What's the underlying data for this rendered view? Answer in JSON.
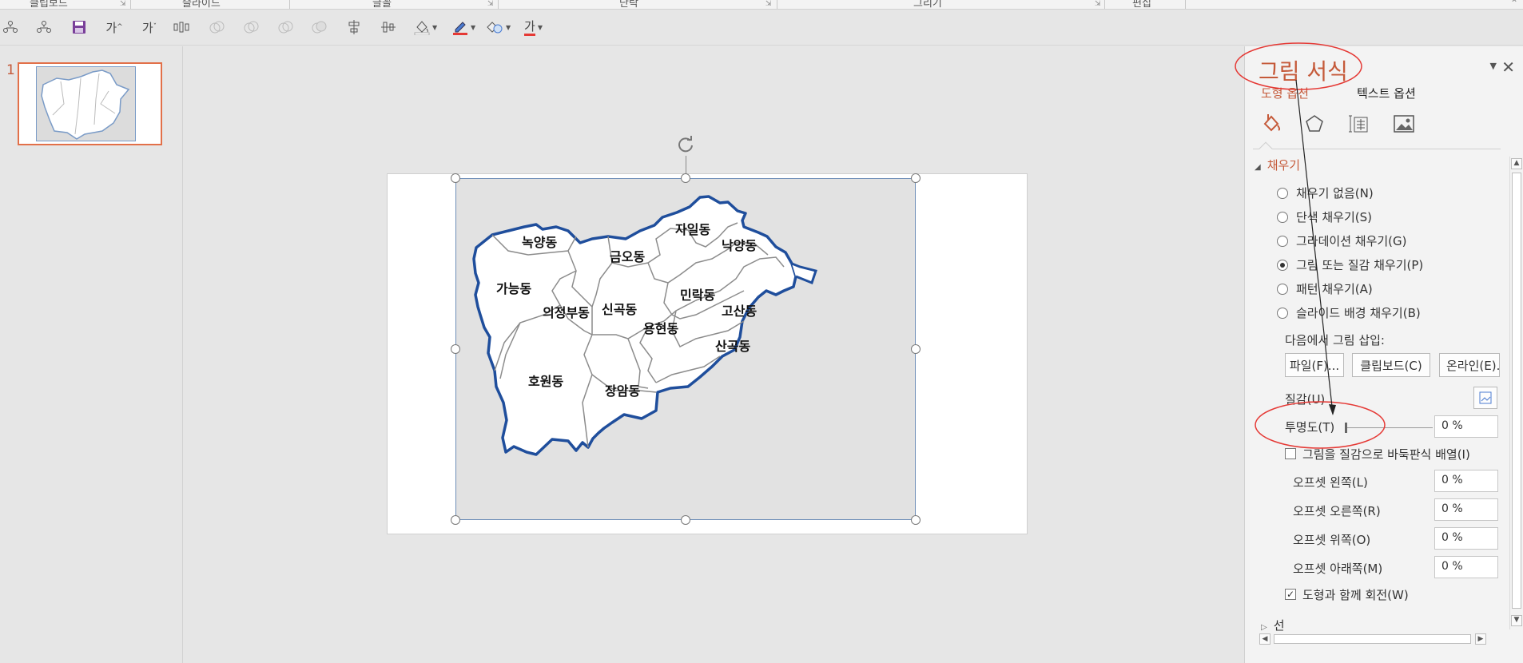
{
  "ribbon": {
    "groups": [
      "클립보드",
      "슬라이드",
      "글꼴",
      "단락",
      "그리기",
      "편집"
    ]
  },
  "toolbar": {
    "font_size_up": "가",
    "font_size_down": "가",
    "text_color_label": "가"
  },
  "slides_panel": {
    "slide_number": "1"
  },
  "map": {
    "districts": [
      "녹양동",
      "금오동",
      "자일동",
      "낙양동",
      "가능동",
      "의정부동",
      "신곡동",
      "민락동",
      "고산동",
      "용현동",
      "산곡동",
      "호원동",
      "장암동"
    ]
  },
  "format_pane": {
    "title": "그림 서식",
    "tabs": [
      "도형 옵션",
      "텍스트 옵션"
    ],
    "fill_section": "채우기",
    "fill_options": [
      {
        "label": "채우기 없음(N)",
        "selected": false
      },
      {
        "label": "단색 채우기(S)",
        "selected": false
      },
      {
        "label": "그라데이션 채우기(G)",
        "selected": false
      },
      {
        "label": "그림 또는 질감 채우기(P)",
        "selected": true
      },
      {
        "label": "패턴 채우기(A)",
        "selected": false
      },
      {
        "label": "슬라이드 배경 채우기(B)",
        "selected": false
      }
    ],
    "insert_from_label": "다음에서 그림 삽입:",
    "insert_buttons": [
      "파일(F)...",
      "클립보드(C)",
      "온라인(E)..."
    ],
    "texture_label": "질감(U)",
    "transparency_label": "투명도(T)",
    "transparency_value": "0 %",
    "transparency_level": 0,
    "tile_checkbox_label": "그림을 질감으로 바둑판식 배열(I)",
    "tile_checked": false,
    "offsets": [
      {
        "label": "오프셋 왼쪽(L)",
        "value": "0 %"
      },
      {
        "label": "오프셋 오른쪽(R)",
        "value": "0 %"
      },
      {
        "label": "오프셋 위쪽(O)",
        "value": "0 %"
      },
      {
        "label": "오프셋 아래쪽(M)",
        "value": "0 %"
      }
    ],
    "rotate_checkbox_label": "도형과 함께 회전(W)",
    "rotate_checked": true,
    "line_section": "선"
  },
  "colors": {
    "accent": "#c55a3a",
    "annotation": "#e53935",
    "map_border": "#1f4e9c"
  }
}
